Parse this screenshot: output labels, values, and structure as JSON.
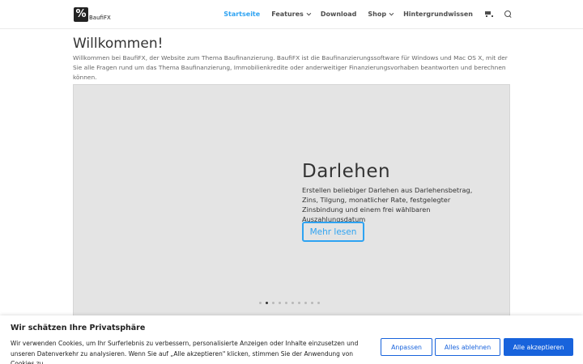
{
  "header": {
    "logo_symbol": "%",
    "logo_text": "BaufiFX",
    "nav": [
      {
        "label": "Startseite",
        "active": true,
        "dropdown": false
      },
      {
        "label": "Features",
        "active": false,
        "dropdown": true
      },
      {
        "label": "Download",
        "active": false,
        "dropdown": false
      },
      {
        "label": "Shop",
        "active": false,
        "dropdown": true
      },
      {
        "label": "Hintergrundwissen",
        "active": false,
        "dropdown": false
      }
    ],
    "icons": [
      "cart-icon",
      "search-icon"
    ]
  },
  "main": {
    "title": "Willkommen!",
    "intro": "Willkommen bei BaufiFX, der Website zum Thema Baufinanzierung. BaufiFX ist die Baufinanzierungssoftware für Windows und Mac OS X, mit der Sie alle Fragen rund um das Thema Baufinanzierung, Immobilienkredite oder anderweitiger Finanzierungsvorhaben beantworten und berechnen können."
  },
  "slider": {
    "title": "Darlehen",
    "text": "Erstellen beliebiger Darlehen aus Darlehensbetrag, Zins, Tilgung, monatlicher Rate, festgelegter Zinsbindung und einem frei wählbaren Auszahlungsdatum",
    "button_label": "Mehr lesen",
    "dot_count": 10,
    "active_dot": 1
  },
  "cookie": {
    "title": "Wir schätzen Ihre Privatsphäre",
    "text": "Wir verwenden Cookies, um Ihr Surferlebnis zu verbessern, personalisierte Anzeigen oder Inhalte einzusetzen und unseren Datenverkehr zu analysieren. Wenn Sie auf „Alle akzeptieren\" klicken, stimmen Sie der Anwendung von Cookies zu.",
    "customize_label": "Anpassen",
    "reject_label": "Alles ablehnen",
    "accept_label": "Alle akzeptieren"
  },
  "colors": {
    "accent": "#2ea3f2",
    "cookie_button": "#1863dc",
    "slider_bg": "#e4e4e4"
  }
}
